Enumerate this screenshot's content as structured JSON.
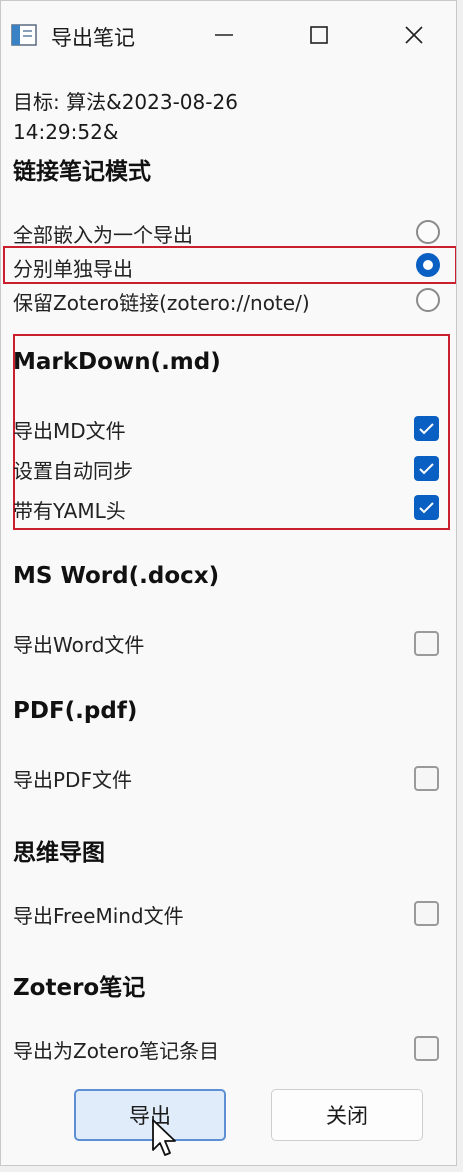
{
  "window": {
    "title": "导出笔记"
  },
  "target": {
    "line1": "目标: 算法&2023-08-26",
    "line2": "14:29:52&"
  },
  "link_mode": {
    "heading": "链接笔记模式",
    "options": [
      {
        "label": "全部嵌入为一个导出",
        "selected": false
      },
      {
        "label": "分别单独导出",
        "selected": true
      },
      {
        "label": "保留Zotero链接(zotero://note/)",
        "selected": false
      }
    ]
  },
  "markdown": {
    "heading": "MarkDown(.md)",
    "options": [
      {
        "label": "导出MD文件",
        "checked": true
      },
      {
        "label": "设置自动同步",
        "checked": true
      },
      {
        "label": "带有YAML头",
        "checked": true
      }
    ]
  },
  "word": {
    "heading": "MS Word(.docx)",
    "option": {
      "label": "导出Word文件",
      "checked": false
    }
  },
  "pdf": {
    "heading": "PDF(.pdf)",
    "option": {
      "label": "导出PDF文件",
      "checked": false
    }
  },
  "mindmap": {
    "heading": "思维导图",
    "option": {
      "label": "导出FreeMind文件",
      "checked": false
    }
  },
  "zotero": {
    "heading": "Zotero笔记",
    "option": {
      "label": "导出为Zotero笔记条目",
      "checked": false
    }
  },
  "buttons": {
    "export": "导出",
    "close": "关闭"
  },
  "colors": {
    "accent": "#0a5fc2",
    "highlight": "#cc1f2e"
  },
  "icons": {
    "app": "window-app-icon",
    "minimize": "minimize-icon",
    "maximize": "maximize-icon",
    "close": "close-icon",
    "cursor": "mouse-pointer-icon"
  }
}
